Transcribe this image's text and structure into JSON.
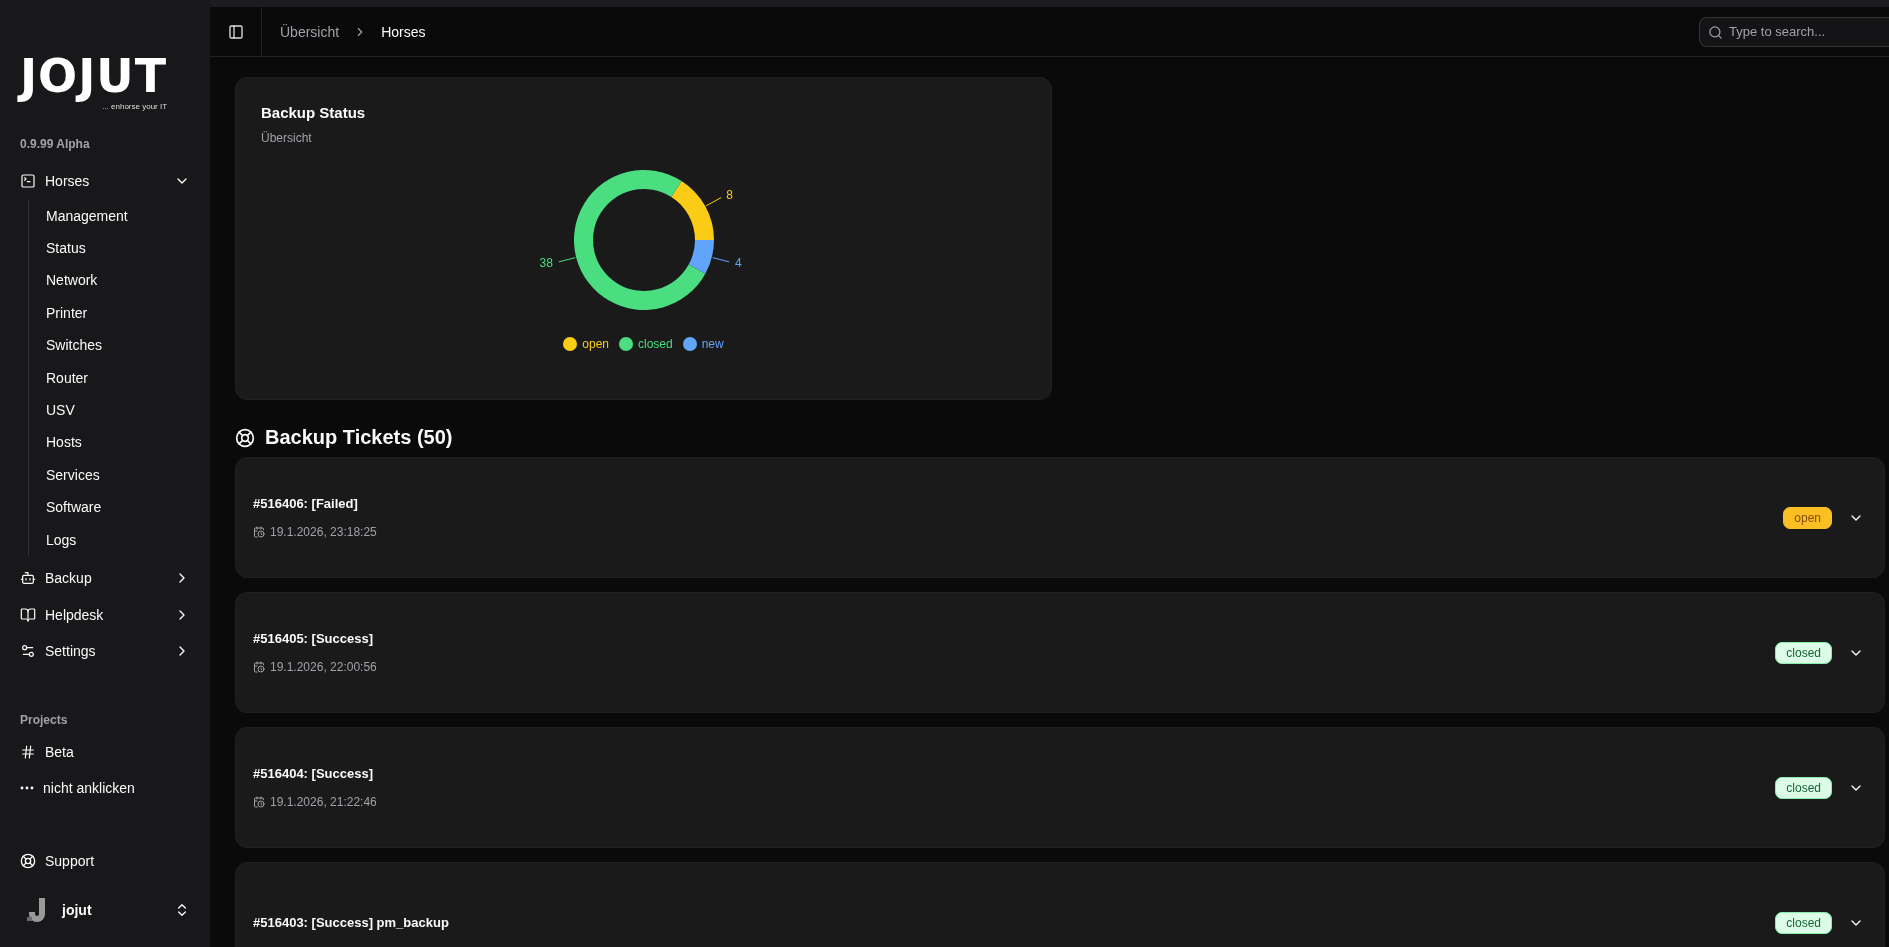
{
  "sidebar": {
    "logo": {
      "wordmark": "JOJUT",
      "tagline": "... enhorse your IT"
    },
    "version": "0.9.99 Alpha",
    "nav": [
      {
        "label": "Horses",
        "expanded": true,
        "children": [
          {
            "label": "Management"
          },
          {
            "label": "Status"
          },
          {
            "label": "Network"
          },
          {
            "label": "Printer"
          },
          {
            "label": "Switches"
          },
          {
            "label": "Router"
          },
          {
            "label": "USV"
          },
          {
            "label": "Hosts"
          },
          {
            "label": "Services"
          },
          {
            "label": "Software"
          },
          {
            "label": "Logs"
          }
        ]
      },
      {
        "label": "Backup",
        "expanded": false
      },
      {
        "label": "Helpdesk",
        "expanded": false
      },
      {
        "label": "Settings",
        "expanded": false
      }
    ],
    "projects_label": "Projects",
    "projects": [
      {
        "label": "Beta"
      },
      {
        "label": "nicht anklicken"
      }
    ],
    "support": "Support",
    "user": "jojut"
  },
  "header": {
    "breadcrumb": [
      "Übersicht",
      "Horses"
    ],
    "search": {
      "placeholder": "Type to search..."
    }
  },
  "status_card": {
    "title": "Backup Status",
    "subtitle": "Übersicht",
    "chart_data": {
      "type": "donut",
      "data_labels": true,
      "categories": [
        "open",
        "closed",
        "new"
      ],
      "values": [
        8,
        38,
        4
      ],
      "colors": [
        "#facc15",
        "#4ade80",
        "#60a5fa"
      ]
    }
  },
  "tickets": {
    "heading": "Backup Tickets (50)",
    "items": [
      {
        "title": "#516406: [Failed]",
        "date": "19.1.2026, 23:18:25",
        "status": {
          "label": "open",
          "kind": "open"
        }
      },
      {
        "title": "#516405: [Success]",
        "date": "19.1.2026, 22:00:56",
        "status": {
          "label": "closed",
          "kind": "closed"
        }
      },
      {
        "title": "#516404: [Success]",
        "date": "19.1.2026, 21:22:46",
        "status": {
          "label": "closed",
          "kind": "closed"
        }
      },
      {
        "title": "#516403: [Success] pm_backup",
        "status": {
          "label": "closed",
          "kind": "closed"
        }
      }
    ]
  }
}
